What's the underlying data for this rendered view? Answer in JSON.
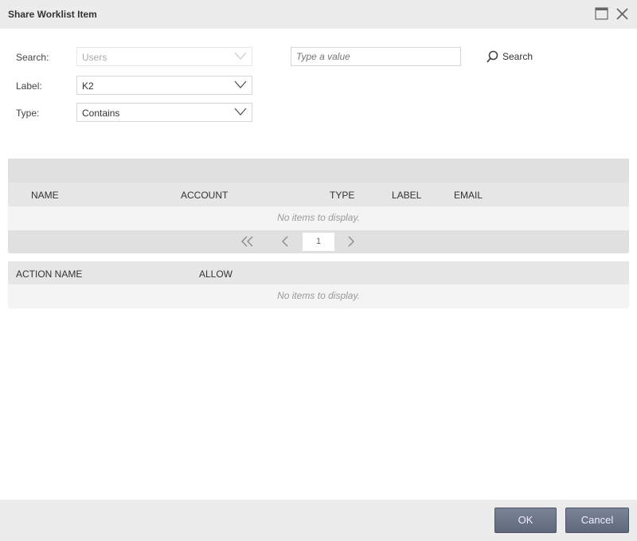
{
  "dialog": {
    "title": "Share Worklist Item"
  },
  "form": {
    "search_label": "Search:",
    "search_value": "Users",
    "label_label": "Label:",
    "label_value": "K2",
    "type_label": "Type:",
    "type_value": "Contains",
    "value_placeholder": "Type a value",
    "search_button": "Search"
  },
  "users_grid": {
    "columns": [
      "NAME",
      "ACCOUNT",
      "TYPE",
      "LABEL",
      "EMAIL"
    ],
    "empty": "No items to display.",
    "page": "1"
  },
  "actions_grid": {
    "columns": [
      "ACTION NAME",
      "ALLOW"
    ],
    "empty": "No items to display."
  },
  "footer": {
    "ok": "OK",
    "cancel": "Cancel"
  }
}
